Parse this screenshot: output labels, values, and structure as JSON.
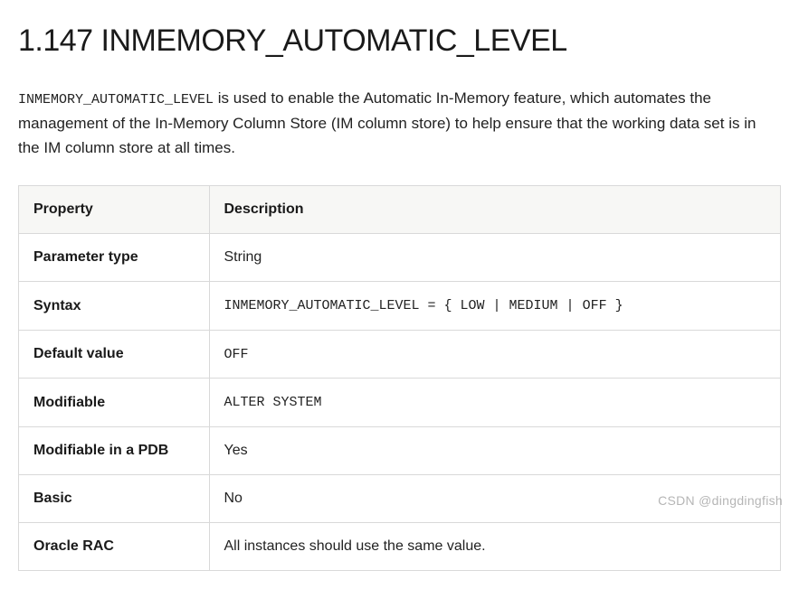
{
  "heading": "1.147 INMEMORY_AUTOMATIC_LEVEL",
  "intro_code": "INMEMORY_AUTOMATIC_LEVEL",
  "intro_text": " is used to enable the Automatic In-Memory feature, which automates the management of the In-Memory Column Store (IM column store) to help ensure that the working data set is in the IM column store at all times.",
  "table": {
    "head_property": "Property",
    "head_description": "Description",
    "rows": [
      {
        "property": "Parameter type",
        "value": "String",
        "mono": false
      },
      {
        "property": "Syntax",
        "value": "INMEMORY_AUTOMATIC_LEVEL = { LOW | MEDIUM | OFF }",
        "mono": true
      },
      {
        "property": "Default value",
        "value": "OFF",
        "mono": true
      },
      {
        "property": "Modifiable",
        "value": "ALTER SYSTEM",
        "mono": true
      },
      {
        "property": "Modifiable in a PDB",
        "value": "Yes",
        "mono": false
      },
      {
        "property": "Basic",
        "value": "No",
        "mono": false
      },
      {
        "property": "Oracle RAC",
        "value": "All instances should use the same value.",
        "mono": false
      }
    ]
  },
  "watermark": "CSDN @dingdingfish"
}
